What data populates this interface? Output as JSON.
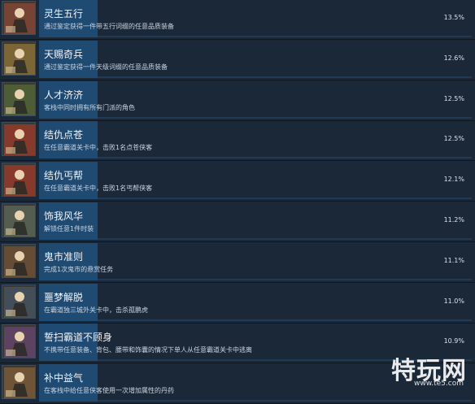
{
  "achievements": [
    {
      "name": "灵生五行",
      "desc": "通过鉴定获得一件带五行词缀的任意品质装备",
      "percent": "13.5%",
      "icon": "wuxing-portrait-icon",
      "accent": "#a84a3a"
    },
    {
      "name": "天赐奇兵",
      "desc": "通过鉴定获得一件天级词缀的任意品质装备",
      "percent": "12.6%",
      "icon": "sword-weapon-icon",
      "accent": "#b48a3a"
    },
    {
      "name": "人才济济",
      "desc": "客栈中同时拥有所有门派的角色",
      "percent": "12.5%",
      "icon": "group-characters-icon",
      "accent": "#5e7a3a"
    },
    {
      "name": "结仇点苍",
      "desc": "在任意霸道关卡中，击败1名点苍侠客",
      "percent": "12.5%",
      "icon": "diancang-fighter-icon",
      "accent": "#c23a2a"
    },
    {
      "name": "结仇丐帮",
      "desc": "在任意霸道关卡中，击败1名丐帮侠客",
      "percent": "12.1%",
      "icon": "gaibang-fighter-icon",
      "accent": "#c23a2a"
    },
    {
      "name": "饰我风华",
      "desc": "解锁任意1件时装",
      "percent": "11.2%",
      "icon": "fashion-costume-icon",
      "accent": "#6a7a6a"
    },
    {
      "name": "鬼市准则",
      "desc": "完成1次鬼市的悬赏任务",
      "percent": "11.1%",
      "icon": "ghost-market-icon",
      "accent": "#8a5a3a"
    },
    {
      "name": "噩梦解脱",
      "desc": "在霸道独三城外关卡中，击杀孤鹏虎",
      "percent": "11.0%",
      "icon": "nightmare-figure-icon",
      "accent": "#4a5e7a"
    },
    {
      "name": "誓扫霸道不顾身",
      "desc": "不携带任意装备、背包、腰带和饰囊的情况下单人从任意霸道关卡中逃离",
      "percent": "10.9%",
      "icon": "lone-warrior-icon",
      "accent": "#7a4a8a"
    },
    {
      "name": "补中益气",
      "desc": "在客栈中给任意侠客使用一次增加属性的丹药",
      "percent": "",
      "icon": "elixir-chest-icon",
      "accent": "#9a6a3a"
    }
  ],
  "watermark": {
    "brand": "特玩网",
    "url": "www.te5.com"
  }
}
